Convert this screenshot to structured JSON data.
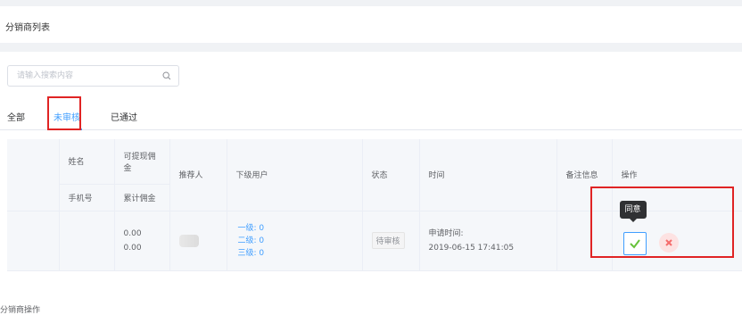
{
  "header": {
    "title": "分销商列表"
  },
  "search": {
    "placeholder": "请输入搜索内容",
    "icon": "search-icon"
  },
  "tabs": [
    {
      "label": "全部",
      "active": false
    },
    {
      "label": "未审核",
      "active": true
    },
    {
      "label": "已通过",
      "active": false
    }
  ],
  "table": {
    "headers": {
      "name": "姓名",
      "phone": "手机号",
      "withdrawable": "可提现佣金",
      "cumulative": "累计佣金",
      "referrer": "推荐人",
      "subordinates": "下级用户",
      "status": "状态",
      "time": "时间",
      "remark": "备注信息",
      "actions": "操作"
    },
    "rows": [
      {
        "withdrawable": "0.00",
        "cumulative": "0.00",
        "level1": "一级: 0",
        "level2": "二级: 0",
        "level3": "三级: 0",
        "status": "待审核",
        "time_label": "申请时间:",
        "time_value": "2019-06-15 17:41:05"
      }
    ]
  },
  "actions": {
    "approve_tooltip": "同意",
    "approve_icon": "check-icon",
    "reject_icon": "close-icon"
  },
  "footer": {
    "text": "分销商操作"
  },
  "colors": {
    "accent": "#409eff",
    "highlight": "#e02424",
    "danger": "#f56c6c"
  }
}
